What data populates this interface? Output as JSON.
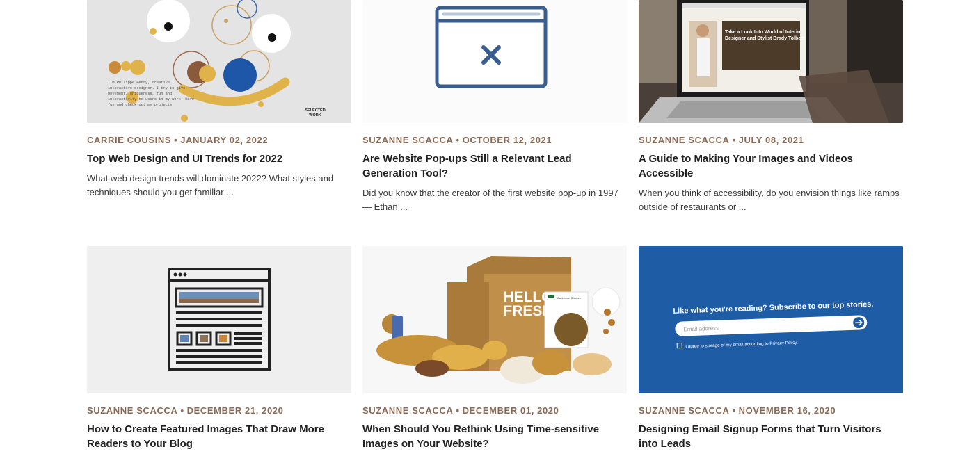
{
  "posts": [
    {
      "author": "CARRIE COUSINS",
      "date": "JANUARY 02, 2022",
      "title": "Top Web Design and UI Trends for 2022",
      "excerpt": "What web design trends will dominate 2022? What styles and techniques should you get familiar ...",
      "thumb_text": {
        "intro": "I'm Philippe Henry, creative interactive designer. I try to give movement, uniqueness, fun and interactivity to users in my work. Have fun and check out my projects",
        "badge_line1": "SELECTED",
        "badge_line2": "WORK"
      }
    },
    {
      "author": "SUZANNE SCACCA",
      "date": "OCTOBER 12, 2021",
      "title": "Are Website Pop-ups Still a Relevant Lead Generation Tool?",
      "excerpt": "Did you know that the creator of the first website pop-up in 1997 — Ethan ..."
    },
    {
      "author": "SUZANNE SCACCA",
      "date": "JULY 08, 2021",
      "title": "A Guide to Making Your Images and Videos Accessible",
      "excerpt": "When you think of accessibility, do you envision things like ramps outside of restaurants or ...",
      "thumb_text": {
        "screen_headline": "Take a Look Into World of Interior Designer and Stylist Brady Tolbert"
      }
    },
    {
      "author": "SUZANNE SCACCA",
      "date": "DECEMBER 21, 2020",
      "title": "How to Create Featured Images That Draw More Readers to Your Blog"
    },
    {
      "author": "SUZANNE SCACCA",
      "date": "DECEMBER 01, 2020",
      "title": "When Should You Rethink Using Time-sensitive Images on Your Website?",
      "thumb_text": {
        "box_line1": "HELLO",
        "box_line2": "FRESH",
        "card_label": "Caribbean Chicken"
      }
    },
    {
      "author": "SUZANNE SCACCA",
      "date": "NOVEMBER 16, 2020",
      "title": "Designing Email Signup Forms that Turn Visitors into Leads",
      "thumb_text": {
        "heading": "Like what you're reading? Subscribe to our top stories.",
        "email_placeholder": "Email address",
        "consent": "I agree to storage of my email according to Privacy Policy."
      }
    }
  ],
  "separator": "•",
  "colors": {
    "meta": "#8a6a55",
    "signup_blue": "#1f5ca6",
    "popup_blue": "#3a5d8f"
  }
}
